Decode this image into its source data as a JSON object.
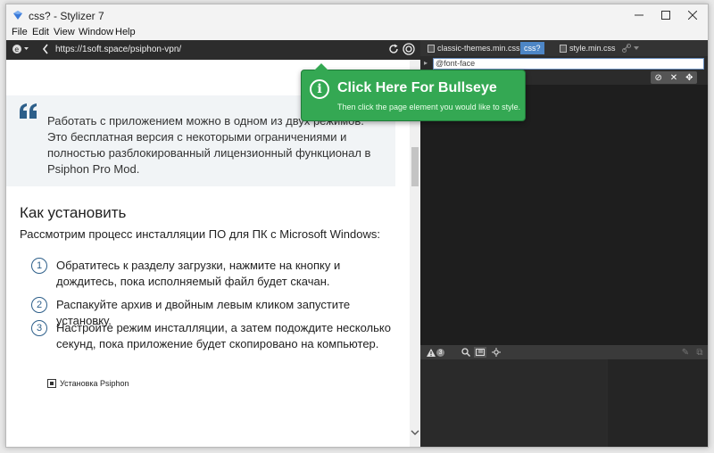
{
  "window": {
    "title": "css? - Stylizer 7",
    "minimize_icon": "minimize-icon",
    "maximize_icon": "maximize-icon",
    "close_icon": "close-icon"
  },
  "menu": [
    "File",
    "Edit",
    "View",
    "Window",
    "Help"
  ],
  "browser": {
    "url": "https://1soft.space/psiphon-vpn/"
  },
  "page": {
    "quote_text": "Работать с приложением можно в одном из двух режимов. Это бесплатная версия с некоторыми ограничениями и полностью разблокированный лицензионный функционал в Psiphon Pro Mod.",
    "heading": "Как установить",
    "intro": "Рассмотрим процесс инсталляции ПО для ПК с Microsoft Windows:",
    "steps": [
      {
        "num": "1",
        "text": "Обратитесь к разделу загрузки, нажмите на кнопку и дождитесь, пока исполняемый файл будет скачан."
      },
      {
        "num": "2",
        "text": "Распакуйте архив и двойным левым кликом запустите установку."
      },
      {
        "num": "3",
        "text": "Настройте режим инсталляции, а затем подождите несколько секунд, пока приложение будет скопировано на компьютер."
      }
    ],
    "image_caption": "Установка Psiphon"
  },
  "stylizer": {
    "tabs": [
      "classic-themes.min.css",
      "css?",
      "style.min.css"
    ],
    "selector_value": "@font-face",
    "warning_count": "3"
  },
  "tooltip": {
    "title": "Click Here For Bullseye",
    "subtitle": "Then click the page element you would like to style."
  },
  "colors": {
    "accent_green": "#34a853",
    "tab_active": "#4d86c6",
    "step_blue": "#2d5f8a"
  }
}
